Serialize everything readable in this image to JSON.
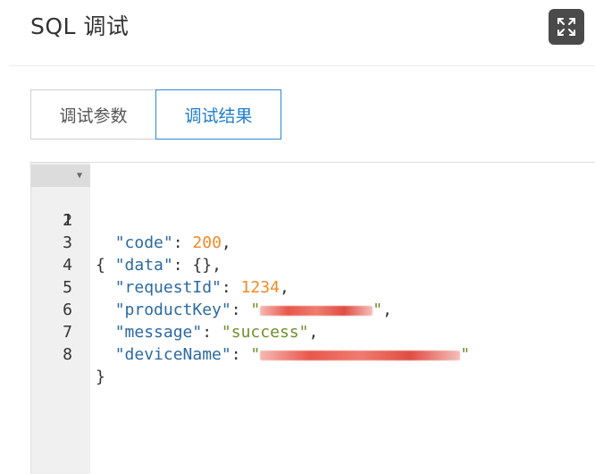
{
  "header": {
    "title": "SQL 调试",
    "expand_icon": "expand-icon"
  },
  "tabs": [
    {
      "label": "调试参数",
      "active": false
    },
    {
      "label": "调试结果",
      "active": true
    }
  ],
  "editor": {
    "lines": [
      {
        "num": "1",
        "open_brace": "{"
      },
      {
        "num": "2",
        "key": "\"code\"",
        "sep": ": ",
        "value": "200",
        "trail": ","
      },
      {
        "num": "3",
        "key": "\"data\"",
        "sep": ": ",
        "value": "{}",
        "trail": ","
      },
      {
        "num": "4",
        "key": "\"requestId\"",
        "sep": ": ",
        "value": "1234",
        "trail": ","
      },
      {
        "num": "5",
        "key": "\"productKey\"",
        "sep": ": ",
        "quote_open": "\"",
        "quote_close": "\"",
        "trail": ","
      },
      {
        "num": "6",
        "key": "\"message\"",
        "sep": ": ",
        "value": "\"success\"",
        "trail": ","
      },
      {
        "num": "7",
        "key": "\"deviceName\"",
        "sep": ": ",
        "quote_open": "\"",
        "quote_close": "\""
      },
      {
        "num": "8",
        "close_brace": "}"
      }
    ],
    "colors": {
      "key": "#2c6aa0",
      "number": "#f08a24",
      "string": "#6f8f2b",
      "active_tab": "#1f7ec9"
    }
  }
}
